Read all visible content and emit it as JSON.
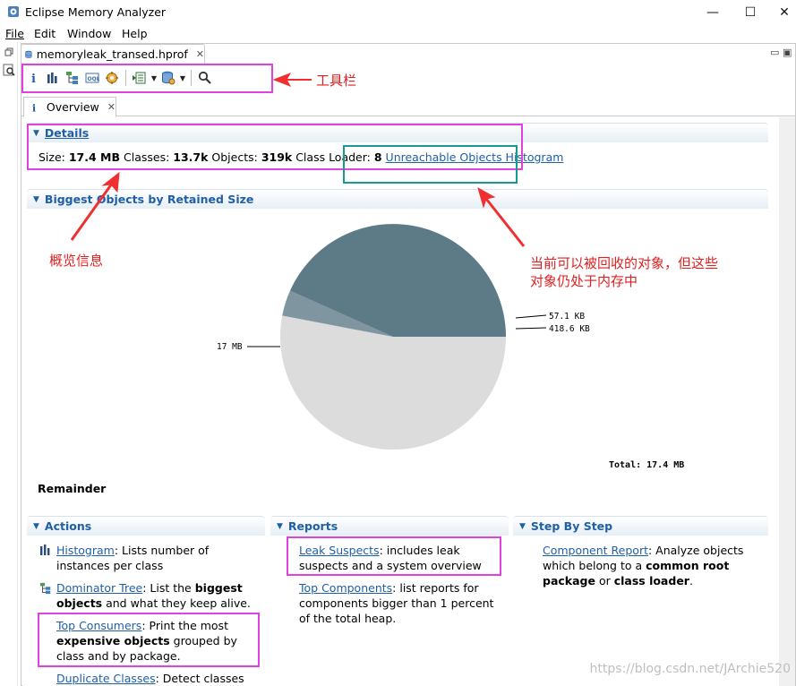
{
  "window": {
    "title": "Eclipse Memory Analyzer",
    "minimize": "—",
    "maximize": "☐",
    "close": "✕"
  },
  "menu": [
    "File",
    "Edit",
    "Window",
    "Help"
  ],
  "editor_tab": {
    "label": "memoryleak_transed.hprof"
  },
  "toolbar": {
    "icons": [
      "info-icon",
      "histogram-icon",
      "dominator-tree-icon",
      "oql-icon",
      "thread-overview-icon",
      "run-expert-report-icon",
      "query-browser-icon",
      "find-object-icon"
    ]
  },
  "overview_tab": {
    "label": "Overview"
  },
  "details": {
    "header": "Details",
    "size_label": "Size: ",
    "size_value": "17.4 MB",
    "classes_label": " Classes: ",
    "classes_value": "13.7k",
    "objects_label": " Objects: ",
    "objects_value": "319k",
    "loader_label": " Class Loader: ",
    "loader_value": "8",
    "unreachable_link": "Unreachable Objects Histogram"
  },
  "biggest": {
    "header": "Biggest Objects by Retained Size",
    "remainder": "Remainder",
    "total": "Total:  17.4 MB"
  },
  "chart_data": {
    "type": "pie",
    "slices": [
      {
        "label": "17 MB",
        "value": 16.92,
        "color": "#dcdcdc"
      },
      {
        "label": "418.6 KB",
        "value": 0.4186,
        "color": "#5d7a87"
      },
      {
        "label": "57.1 KB",
        "value": 0.0571,
        "color": "#7f96a0"
      }
    ],
    "total": "Total:  17.4 MB"
  },
  "actions": {
    "header": "Actions",
    "histogram_link": "Histogram",
    "histogram_desc": ": Lists number of instances per class",
    "dominator_link": "Dominator Tree",
    "dominator_desc1": ": List the ",
    "dominator_bold1": "biggest objects",
    "dominator_desc2": " and what they keep alive.",
    "consumers_link": "Top Consumers",
    "consumers_desc1": ": Print the most ",
    "consumers_bold": "expensive objects",
    "consumers_desc2": " grouped by class and by package.",
    "duplicate_link": "Duplicate Classes",
    "duplicate_desc": ": Detect classes"
  },
  "reports": {
    "header": "Reports",
    "leak_link": "Leak Suspects",
    "leak_desc": ": includes leak suspects and a system overview",
    "top_link": "Top Components",
    "top_desc": ": list reports for components bigger than 1 percent of the total heap."
  },
  "stepbystep": {
    "header": "Step By Step",
    "component_link": "Component Report",
    "component_desc1": ": Analyze objects which belong to a ",
    "component_bold1": "common root package",
    "component_desc2": " or ",
    "component_bold2": "class loader",
    "component_desc3": "."
  },
  "annotations": {
    "toolbar": "工具栏",
    "overview_info": "概览信息",
    "unreachable_line1": "当前可以被回收的对象，但这些",
    "unreachable_line2": "对象仍处于内存中"
  },
  "watermark": "https://blog.csdn.net/JArchie520",
  "colors": {
    "link": "#1f5fa8",
    "highlight": "#e041e0",
    "teal_box": "#159a96",
    "annotation": "#e02020"
  }
}
